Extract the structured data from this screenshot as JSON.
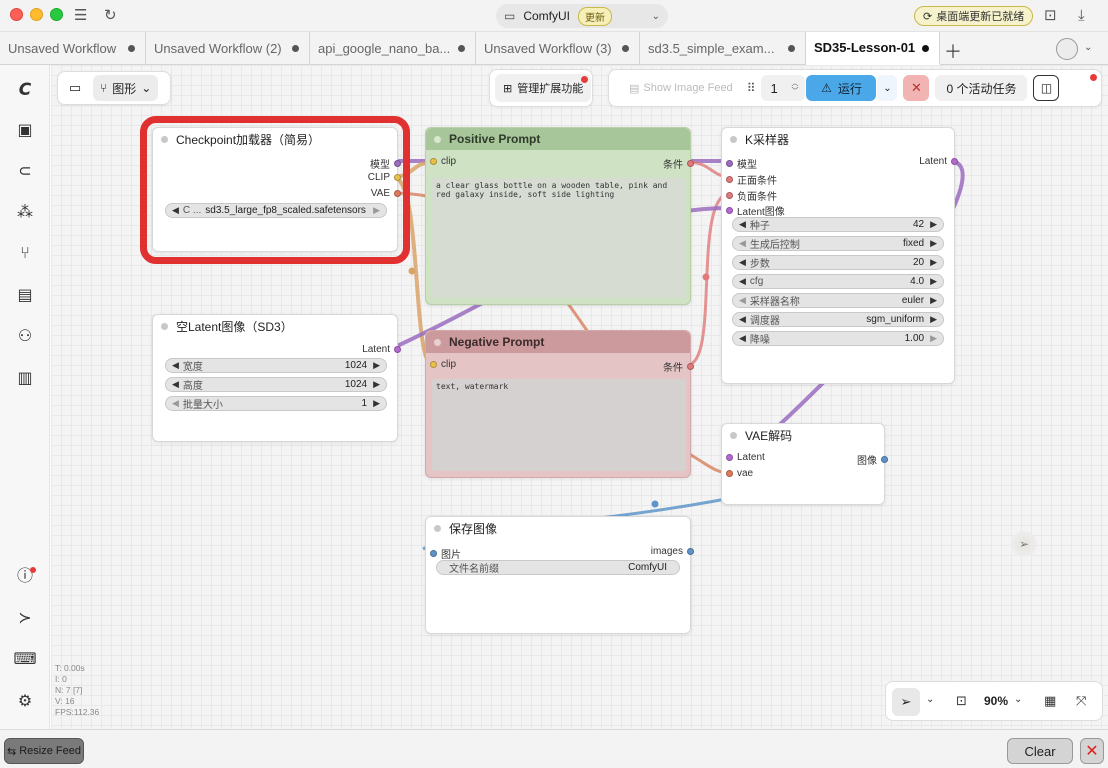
{
  "app": {
    "name": "ComfyUI",
    "update_badge": "更新",
    "update_ready": "桌面端更新已就绪"
  },
  "tabs": [
    {
      "label": "Unsaved Workflow"
    },
    {
      "label": "Unsaved Workflow (2)"
    },
    {
      "label": "api_google_nano_ba..."
    },
    {
      "label": "Unsaved Workflow (3)"
    },
    {
      "label": "sd3.5_simple_exam..."
    },
    {
      "label": "SD35-Lesson-01",
      "active": true
    }
  ],
  "toolbar": {
    "view_mode": "图形",
    "manage_extensions": "管理扩展功能",
    "show_image_feed": "Show Image Feed",
    "batch_count": "1",
    "run": "运行",
    "active_tasks": "0 个活动任务"
  },
  "nodes": {
    "checkpoint": {
      "title": "Checkpoint加载器（简易）",
      "outputs": [
        "模型",
        "CLIP",
        "VAE"
      ],
      "widget_label": "C ...",
      "widget_value": "sd3.5_large_fp8_scaled.safetensors"
    },
    "positive": {
      "title": "Positive Prompt",
      "input": "clip",
      "output": "条件",
      "text": "a clear glass bottle on a wooden table, pink and red galaxy inside, soft side lighting"
    },
    "negative": {
      "title": "Negative Prompt",
      "input": "clip",
      "output": "条件",
      "text": "text, watermark"
    },
    "latent": {
      "title": "空Latent图像（SD3）",
      "output": "Latent",
      "widgets": [
        {
          "label": "宽度",
          "value": "1024"
        },
        {
          "label": "高度",
          "value": "1024"
        },
        {
          "label": "批量大小",
          "value": "1"
        }
      ]
    },
    "ksampler": {
      "title": "K采样器",
      "inputs": [
        "模型",
        "正面条件",
        "负面条件",
        "Latent图像"
      ],
      "output": "Latent",
      "widgets": [
        {
          "label": "种子",
          "value": "42"
        },
        {
          "label": "生成后控制",
          "value": "fixed"
        },
        {
          "label": "步数",
          "value": "20"
        },
        {
          "label": "cfg",
          "value": "4.0"
        },
        {
          "label": "采样器名称",
          "value": "euler"
        },
        {
          "label": "调度器",
          "value": "sgm_uniform"
        },
        {
          "label": "降噪",
          "value": "1.00"
        }
      ]
    },
    "vae_decode": {
      "title": "VAE解码",
      "inputs": [
        "Latent",
        "vae"
      ],
      "output": "图像"
    },
    "save_image": {
      "title": "保存图像",
      "input": "图片",
      "output": "images",
      "widget_label": "文件名前缀",
      "widget_value": "ComfyUI"
    }
  },
  "stats": {
    "t": "T: 0.00s",
    "i": "I: 0",
    "n": "N: 7 [7]",
    "v": "V: 16",
    "fps": "FPS:112.36"
  },
  "zoom": {
    "level": "90%"
  },
  "bottom": {
    "resize_feed": "Resize Feed",
    "clear": "Clear"
  },
  "colors": {
    "highlight_red": "#e03030",
    "run_blue": "#4aa8e8",
    "positive_header": "#a7c79a",
    "positive_body": "#cfe2c4",
    "negative_header": "#cc9a9c",
    "negative_body": "#e4c4c5",
    "link_purple": "#9b6cc0",
    "link_orange": "#d9a36a",
    "link_blue": "#5e95c9"
  }
}
